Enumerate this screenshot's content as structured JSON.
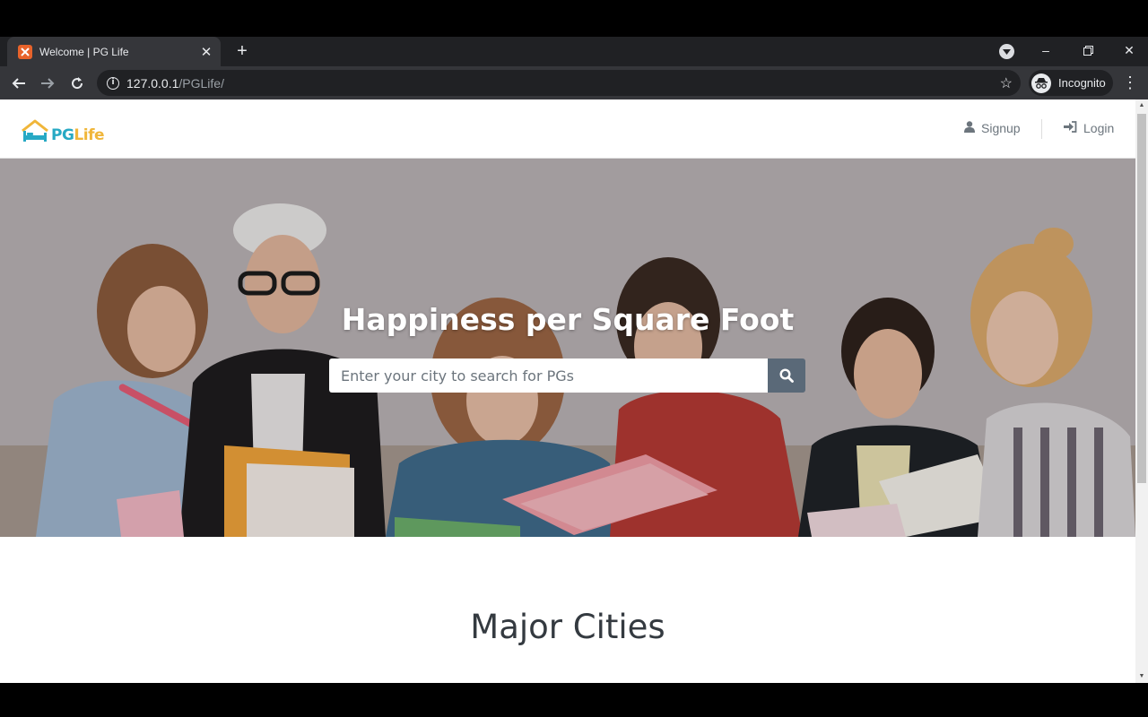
{
  "browser": {
    "tab_title": "Welcome | PG Life",
    "tab_close": "✕",
    "new_tab": "+",
    "url_host": "127.0.0.1",
    "url_path": "/PGLife/",
    "incognito_label": "Incognito",
    "icons": [
      "back-arrow-icon",
      "forward-arrow-icon",
      "reload-icon",
      "info-icon",
      "star-icon",
      "incognito-icon",
      "menu-icon",
      "minimize-icon",
      "restore-icon",
      "close-icon"
    ]
  },
  "site": {
    "logo": {
      "pg": "PG",
      "life": "Life"
    },
    "nav": {
      "signup": "Signup",
      "login": "Login"
    },
    "hero": {
      "title": "Happiness per Square Foot",
      "search_placeholder": "Enter your city to search for PGs"
    },
    "section_title": "Major Cities"
  },
  "colors": {
    "logo_blue": "#27a9c4",
    "logo_yellow": "#f0b63a",
    "search_button": "#5a6978"
  }
}
